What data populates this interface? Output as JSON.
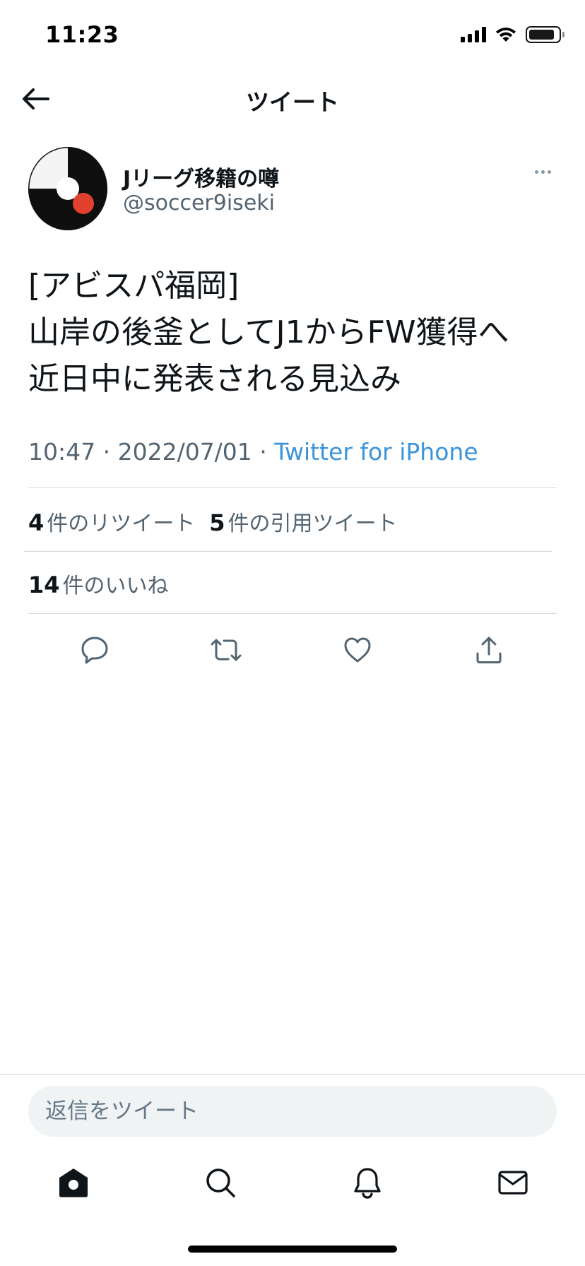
{
  "status_bar": {
    "time": "11:23"
  },
  "header": {
    "title": "ツイート",
    "back_icon": "arrow-left-icon"
  },
  "tweet": {
    "author_name": "Jリーグ移籍の噂",
    "author_handle": "@soccer9iseki",
    "text_lines": [
      "[アビスパ福岡]",
      "山岸の後釜としてJ1からFW獲得へ",
      "近日中に発表される見込み"
    ],
    "time": "10:47",
    "date": "2022/07/01",
    "separator": " · ",
    "source": "Twitter for iPhone",
    "retweets": {
      "count": "4",
      "label": "件のリツイート"
    },
    "quote_tweets": {
      "count": "5",
      "label": "件の引用ツイート"
    },
    "likes": {
      "count": "14",
      "label": "件のいいね"
    }
  },
  "actions": [
    "reply-icon",
    "retweet-icon",
    "like-icon",
    "share-icon"
  ],
  "reply_bar": {
    "placeholder": "返信をツイート"
  },
  "tab_bar": [
    "home-icon",
    "search-icon",
    "notifications-icon",
    "messages-icon"
  ],
  "colors": {
    "accent": "#3b94d9",
    "text_primary": "#0f1419",
    "text_secondary": "#536471",
    "divider": "#cfd9de",
    "input_bg": "#eff3f4",
    "avatar_red": "#e2402e"
  }
}
